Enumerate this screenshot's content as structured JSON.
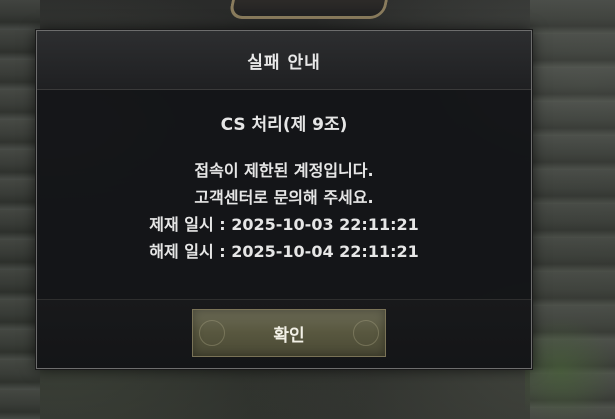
{
  "dialog": {
    "title": "실패 안내",
    "subtitle": "CS 처리(제 9조)",
    "message_lines": [
      "접속이 제한된 계정입니다.",
      "고객센터로 문의해 주세요.",
      "제재 일시 : 2025-10-03 22:11:21",
      "해제 일시 : 2025-10-04 22:11:21"
    ],
    "confirm_label": "확인"
  }
}
